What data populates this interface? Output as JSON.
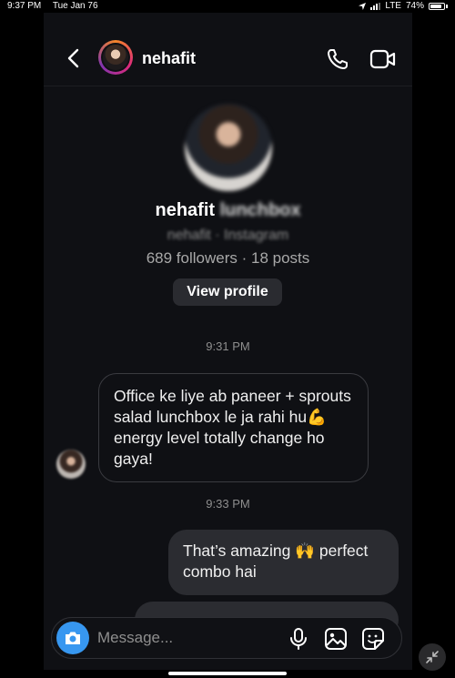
{
  "status_bar": {
    "time": "9:37 PM",
    "date": "Tue Jan 76",
    "network": "LTE",
    "battery": "74%",
    "battery_level": 0.74
  },
  "header": {
    "username": "nehafit"
  },
  "profile": {
    "name": "nehafit",
    "name_suffix": "lunchbox",
    "subline": "nehafit · Instagram",
    "stats": "689 followers · 18 posts",
    "view_profile_label": "View profile"
  },
  "messages": [
    {
      "type": "timestamp",
      "text": "9:31 PM"
    },
    {
      "type": "incoming",
      "text_before": "Office ke liye ab paneer + sprouts salad lunchbox le ja rahi hu",
      "emoji": "💪",
      "text_after": "energy level totally change ho gaya!"
    },
    {
      "type": "timestamp",
      "text": "9:33 PM"
    },
    {
      "type": "outgoing",
      "text_before": "That’s amazing",
      "emoji": "🙌",
      "text_after": "perfect combo hai"
    }
  ],
  "composer": {
    "placeholder": "Message..."
  },
  "icons": [
    "back-arrow-icon",
    "phone-icon",
    "video-icon",
    "camera-icon",
    "microphone-icon",
    "gallery-icon",
    "sticker-icon",
    "shrink-icon"
  ]
}
